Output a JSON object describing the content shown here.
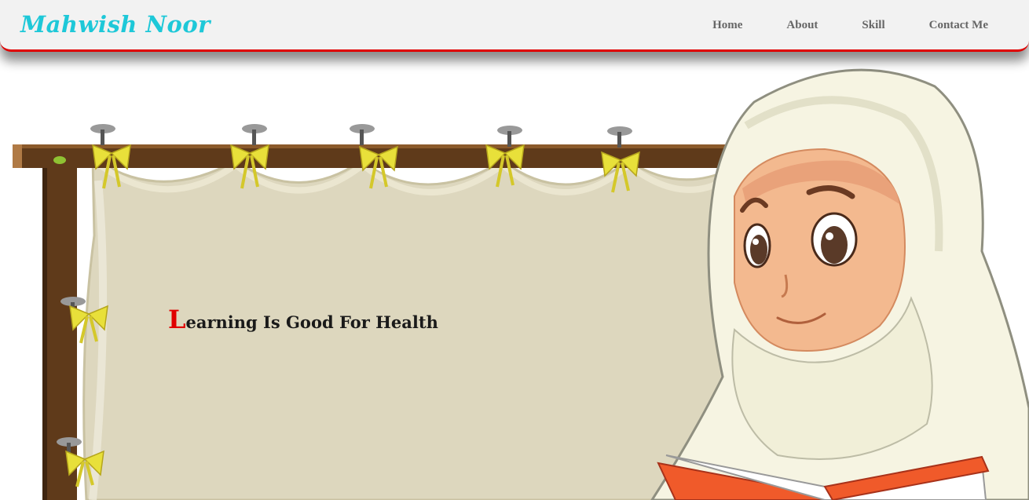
{
  "brand": {
    "name": "Mahwish Noor"
  },
  "nav": {
    "items": [
      {
        "label": "Home"
      },
      {
        "label": "About"
      },
      {
        "label": "Skill"
      },
      {
        "label": "Contact Me"
      }
    ]
  },
  "hero": {
    "first_letter": "L",
    "rest": "earning Is Good For Health"
  },
  "colors": {
    "brand": "#1ec8d8",
    "accent": "#e00000",
    "board": "#ddd7be"
  }
}
